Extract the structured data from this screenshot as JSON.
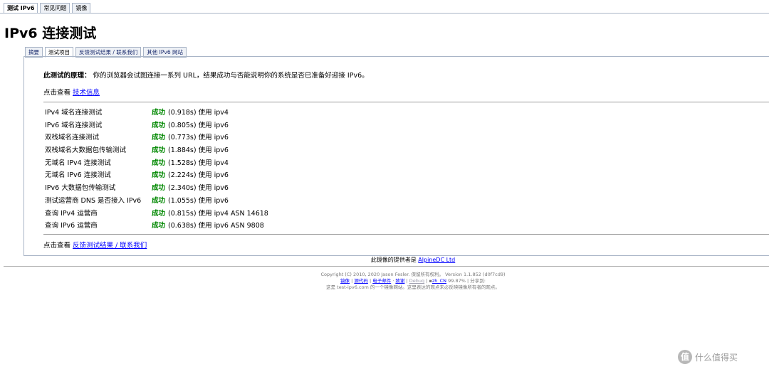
{
  "top_tabs": [
    "测试 IPv6",
    "常见问题",
    "镜像"
  ],
  "page_title": "IPv6 连接测试",
  "sub_tabs": [
    "摘要",
    "测试项目",
    "反馈测试结果 / 联系我们",
    "其他 IPv6 网站"
  ],
  "principle": {
    "label": "此测试的原理：",
    "text": " 你的浏览器会试图连接一系列 URL，结果成功与否能说明你的系统是否已准备好迎接 IPv6。"
  },
  "tech": {
    "prefix": "点击查看 ",
    "link": "技术信息"
  },
  "results": [
    {
      "name": "IPv4 域名连接测试",
      "status": "成功",
      "detail": "(0.918s) 使用 ipv4"
    },
    {
      "name": "IPv6 域名连接测试",
      "status": "成功",
      "detail": "(0.805s) 使用 ipv6"
    },
    {
      "name": "双栈域名连接测试",
      "status": "成功",
      "detail": "(0.773s) 使用 ipv6"
    },
    {
      "name": "双栈域名大数据包传输测试",
      "status": "成功",
      "detail": "(1.884s) 使用 ipv6"
    },
    {
      "name": "无域名 IPv4 连接测试",
      "status": "成功",
      "detail": "(1.528s) 使用 ipv4"
    },
    {
      "name": "无域名 IPv6 连接测试",
      "status": "成功",
      "detail": "(2.224s) 使用 ipv6"
    },
    {
      "name": "IPv6 大数据包传输测试",
      "status": "成功",
      "detail": "(2.340s) 使用 ipv6"
    },
    {
      "name": "测试运营商 DNS 是否接入 IPv6",
      "status": "成功",
      "detail": "(1.055s) 使用 ipv6"
    },
    {
      "name": "查询 IPv4 运营商",
      "status": "成功",
      "detail": "(0.815s) 使用 ipv4 ASN 14618"
    },
    {
      "name": "查询 IPv6 运营商",
      "status": "成功",
      "detail": "(0.638s) 使用 ipv6 ASN 9808"
    }
  ],
  "feedback": {
    "prefix": "点击查看 ",
    "link": "反馈测试结果 / 联系我们"
  },
  "provider": {
    "prefix": "此镜像的提供者是 ",
    "link": "AlpineDC Ltd"
  },
  "footer": {
    "copyright": "Copyright (C) 2010, 2020 Jason Fesler. 保留所有权利。 Version 1.1.852 (d0f7cd9)",
    "links": [
      "镜像",
      "源代码",
      "电子邮件",
      "致谢",
      "Debug",
      "zh_CN"
    ],
    "locale_percent": "99.87%",
    "share": "分享到:",
    "disclaimer": "这是 test-ipv6.com 的一个镜像网站。这里表达的观点未必反映镜像所有者的观点。"
  },
  "watermark": {
    "logo": "值",
    "text": "什么值得买"
  }
}
